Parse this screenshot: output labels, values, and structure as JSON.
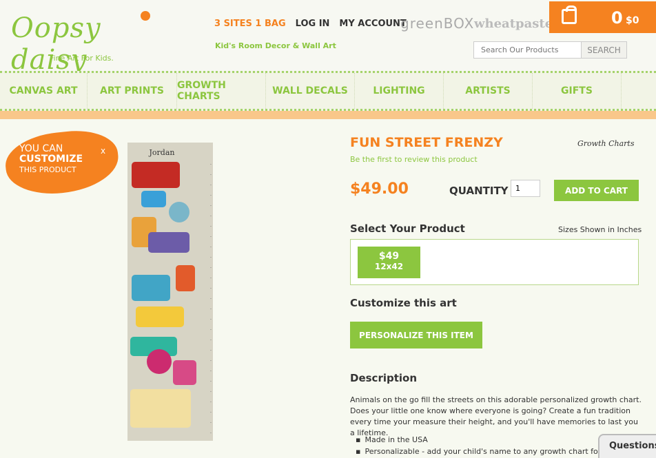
{
  "header": {
    "logo": "Oopsy daisy",
    "logo_tagline": "Fine Art For Kids.",
    "nav_top": [
      "3 SITES 1 BAG",
      "LOG IN",
      "MY ACCOUNT"
    ],
    "tagline": "Kid's Room Decor & Wall Art",
    "partner1": "greenBOX",
    "partner2": "wheatpaste",
    "cart_count": "0",
    "cart_total": "$0",
    "search_placeholder": "Search Our Products",
    "search_button": "SEARCH"
  },
  "main_nav": [
    "CANVAS ART",
    "ART PRINTS",
    "GROWTH CHARTS",
    "WALL DECALS",
    "LIGHTING",
    "ARTISTS",
    "GIFTS"
  ],
  "badge": {
    "line1": "YOU CAN",
    "line2": "CUSTOMIZE",
    "line3": "THIS PRODUCT",
    "close": "x"
  },
  "chart_image": {
    "name": "Jordan"
  },
  "product": {
    "title": "FUN STREET FRENZY",
    "category": "Growth Charts",
    "review_link": "Be the first to review this product",
    "price": "$49.00",
    "quantity_label": "QUANTITY",
    "quantity_value": "1",
    "add_to_cart": "ADD TO CART",
    "select_label": "Select Your Product",
    "sizes_note": "Sizes Shown in Inches",
    "size_price": "$49",
    "size_dim": "12x42",
    "customize_label": "Customize this art",
    "personalize_button": "PERSONALIZE THIS ITEM",
    "description_label": "Description",
    "description": "Animals on the go fill the streets on this adorable personalized growth chart. Does your little one know where everyone is going? Create a fun tradition every time your measure their height, and you'll have memories to last you a lifetime.",
    "bullets": [
      "Made in the USA",
      "Personalizable - add your child's name to any growth chart for a"
    ]
  },
  "questions_tab": "Questions"
}
